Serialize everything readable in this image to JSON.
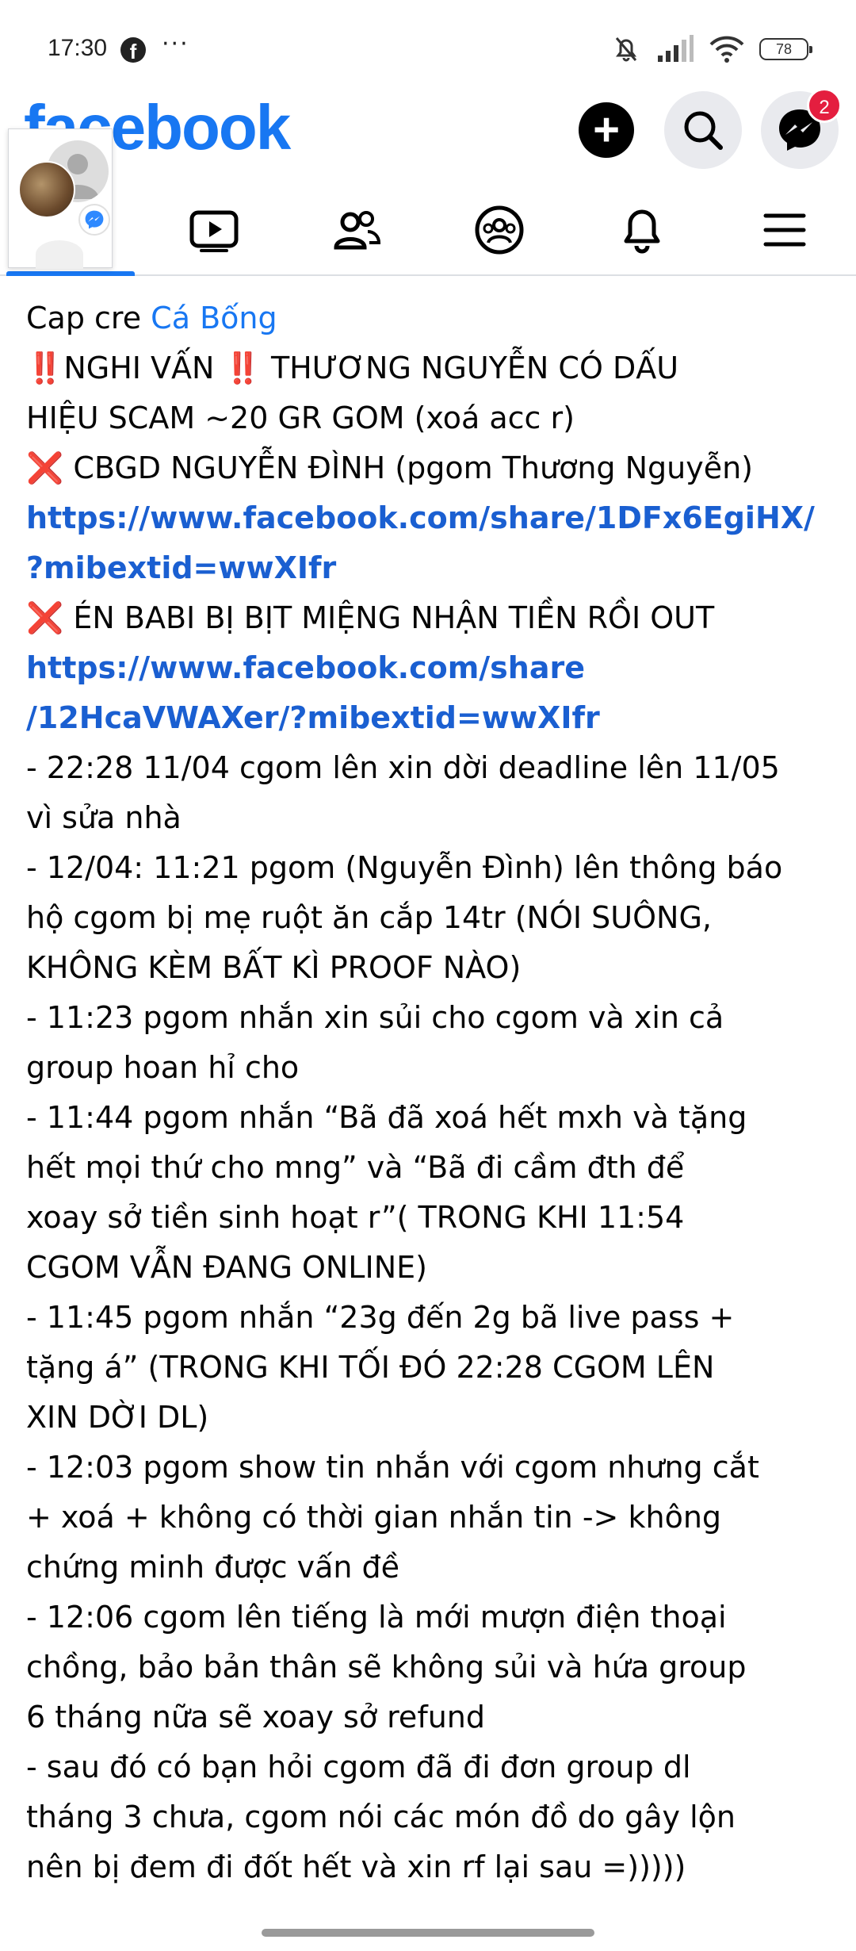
{
  "status_bar": {
    "time": "17:30",
    "app_icon": "facebook-icon",
    "more": "···",
    "battery": "78"
  },
  "header": {
    "logo": "facebook",
    "messenger_badge": "2",
    "brand_color": "#1877f2"
  },
  "tabs": [
    "home",
    "video",
    "friends",
    "groups",
    "notifications",
    "menu"
  ],
  "post": {
    "lines": [
      {
        "segments": [
          {
            "t": "Cap cre ",
            "k": "text"
          },
          {
            "t": "Cá Bống",
            "k": "mention"
          }
        ]
      },
      {
        "segments": [
          {
            "t": "‼️",
            "k": "mark"
          },
          {
            "t": "NGHI VẤN ",
            "k": "text"
          },
          {
            "t": "‼️",
            "k": "mark"
          },
          {
            "t": " THƯƠNG NGUYỄN CÓ DẤU",
            "k": "text"
          }
        ]
      },
      {
        "segments": [
          {
            "t": "HIỆU SCAM ~20 GR GOM (xoá acc r)",
            "k": "text"
          }
        ]
      },
      {
        "segments": [
          {
            "t": "❌",
            "k": "mark"
          },
          {
            "t": " CBGD NGUYỄN ĐÌNH (pgom Thương Nguyễn)",
            "k": "text"
          }
        ]
      },
      {
        "segments": [
          {
            "t": "https://www.facebook.com/share/1DFx6EgiHX/",
            "k": "link"
          }
        ]
      },
      {
        "segments": [
          {
            "t": "?mibextid=wwXIfr",
            "k": "link"
          }
        ]
      },
      {
        "segments": [
          {
            "t": "❌",
            "k": "mark"
          },
          {
            "t": " ÉN BABI BỊ BỊT MIỆNG NHẬN TIỀN RỒI OUT",
            "k": "text"
          }
        ]
      },
      {
        "segments": [
          {
            "t": "https://www.facebook.com/share",
            "k": "link"
          }
        ]
      },
      {
        "segments": [
          {
            "t": "/12HcaVWAXer/?mibextid=wwXIfr",
            "k": "link"
          }
        ]
      },
      {
        "segments": [
          {
            "t": "- 22:28 11/04 cgom lên xin dời deadline lên 11/05",
            "k": "text"
          }
        ]
      },
      {
        "segments": [
          {
            "t": "vì sửa nhà",
            "k": "text"
          }
        ]
      },
      {
        "segments": [
          {
            "t": "- 12/04: 11:21 pgom (Nguyễn Đình) lên thông báo",
            "k": "text"
          }
        ]
      },
      {
        "segments": [
          {
            "t": "hộ cgom bị mẹ ruột ăn cắp 14tr (NÓI SUÔNG,",
            "k": "text"
          }
        ]
      },
      {
        "segments": [
          {
            "t": "KHÔNG KÈM BẤT KÌ PROOF NÀO)",
            "k": "text"
          }
        ]
      },
      {
        "segments": [
          {
            "t": "- 11:23 pgom nhắn xin sủi cho cgom và xin cả",
            "k": "text"
          }
        ]
      },
      {
        "segments": [
          {
            "t": "group hoan hỉ cho",
            "k": "text"
          }
        ]
      },
      {
        "segments": [
          {
            "t": "- 11:44 pgom nhắn “Bã đã xoá hết mxh và tặng",
            "k": "text"
          }
        ]
      },
      {
        "segments": [
          {
            "t": "hết mọi thứ cho mng” và “Bã đi cầm đth để",
            "k": "text"
          }
        ]
      },
      {
        "segments": [
          {
            "t": "xoay sở tiền sinh hoạt r”( TRONG KHI 11:54",
            "k": "text"
          }
        ]
      },
      {
        "segments": [
          {
            "t": "CGOM VẪN ĐANG ONLINE)",
            "k": "text"
          }
        ]
      },
      {
        "segments": [
          {
            "t": "- 11:45 pgom nhắn “23g đến 2g bã live pass +",
            "k": "text"
          }
        ]
      },
      {
        "segments": [
          {
            "t": "tặng á” (TRONG KHI TỐI ĐÓ 22:28 CGOM LÊN",
            "k": "text"
          }
        ]
      },
      {
        "segments": [
          {
            "t": "XIN DỜI DL)",
            "k": "text"
          }
        ]
      },
      {
        "segments": [
          {
            "t": "- 12:03 pgom show tin nhắn với cgom nhưng cắt",
            "k": "text"
          }
        ]
      },
      {
        "segments": [
          {
            "t": "+ xoá + không có thời gian nhắn tin -> không",
            "k": "text"
          }
        ]
      },
      {
        "segments": [
          {
            "t": "chứng minh được vấn đề",
            "k": "text"
          }
        ]
      },
      {
        "segments": [
          {
            "t": "- 12:06 cgom lên tiếng là mới mượn điện thoại",
            "k": "text"
          }
        ]
      },
      {
        "segments": [
          {
            "t": "chồng, bảo bản thân sẽ không sủi và hứa group",
            "k": "text"
          }
        ]
      },
      {
        "segments": [
          {
            "t": "6 tháng nữa sẽ xoay sở refund",
            "k": "text"
          }
        ]
      },
      {
        "segments": [
          {
            "t": "- sau đó có bạn hỏi cgom đã đi đơn group dl",
            "k": "text"
          }
        ]
      },
      {
        "segments": [
          {
            "t": "tháng 3 chưa, cgom nói các món đồ do gây lộn",
            "k": "text"
          }
        ]
      },
      {
        "segments": [
          {
            "t": "nên bị đem đi đốt hết và xin rf lại sau =)))))",
            "k": "text"
          }
        ]
      }
    ]
  }
}
